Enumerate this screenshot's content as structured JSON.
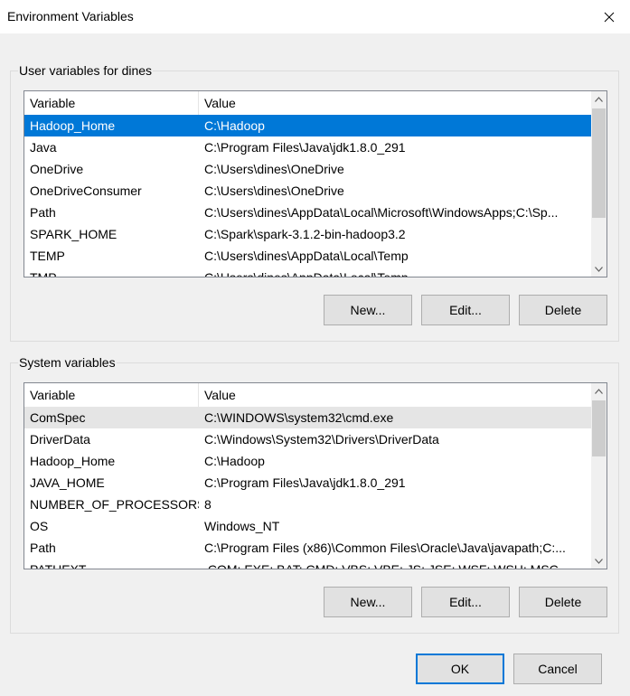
{
  "window": {
    "title": "Environment Variables",
    "close_icon": "close-icon"
  },
  "user_vars": {
    "group_label": "User variables for dines",
    "columns": [
      "Variable",
      "Value"
    ],
    "rows": [
      {
        "name": "Hadoop_Home",
        "value": "C:\\Hadoop"
      },
      {
        "name": "Java",
        "value": "C:\\Program Files\\Java\\jdk1.8.0_291"
      },
      {
        "name": "OneDrive",
        "value": "C:\\Users\\dines\\OneDrive"
      },
      {
        "name": "OneDriveConsumer",
        "value": "C:\\Users\\dines\\OneDrive"
      },
      {
        "name": "Path",
        "value": "C:\\Users\\dines\\AppData\\Local\\Microsoft\\WindowsApps;C:\\Sp..."
      },
      {
        "name": "SPARK_HOME",
        "value": "C:\\Spark\\spark-3.1.2-bin-hadoop3.2"
      },
      {
        "name": "TEMP",
        "value": "C:\\Users\\dines\\AppData\\Local\\Temp"
      },
      {
        "name": "TMP",
        "value": "C:\\Users\\dines\\AppData\\Local\\Temp"
      }
    ],
    "selected_row": "Hadoop_Home",
    "buttons": {
      "new": "New...",
      "edit": "Edit...",
      "delete": "Delete"
    }
  },
  "system_vars": {
    "group_label": "System variables",
    "columns": [
      "Variable",
      "Value"
    ],
    "rows": [
      {
        "name": "ComSpec",
        "value": "C:\\WINDOWS\\system32\\cmd.exe"
      },
      {
        "name": "DriverData",
        "value": "C:\\Windows\\System32\\Drivers\\DriverData"
      },
      {
        "name": "Hadoop_Home",
        "value": "C:\\Hadoop"
      },
      {
        "name": "JAVA_HOME",
        "value": "C:\\Program Files\\Java\\jdk1.8.0_291"
      },
      {
        "name": "NUMBER_OF_PROCESSORS",
        "value": "8"
      },
      {
        "name": "OS",
        "value": "Windows_NT"
      },
      {
        "name": "Path",
        "value": "C:\\Program Files (x86)\\Common Files\\Oracle\\Java\\javapath;C:..."
      },
      {
        "name": "PATHEXT",
        "value": ".COM;.EXE;.BAT;.CMD;.VBS;.VBE;.JS;.JSE;.WSF;.WSH;.MSC"
      }
    ],
    "buttons": {
      "new": "New...",
      "edit": "Edit...",
      "delete": "Delete"
    }
  },
  "footer": {
    "ok": "OK",
    "cancel": "Cancel"
  },
  "colors": {
    "selection": "#0078d7",
    "dialog_bg": "#f0f0f0",
    "hover_row": "#e5e5e5"
  }
}
